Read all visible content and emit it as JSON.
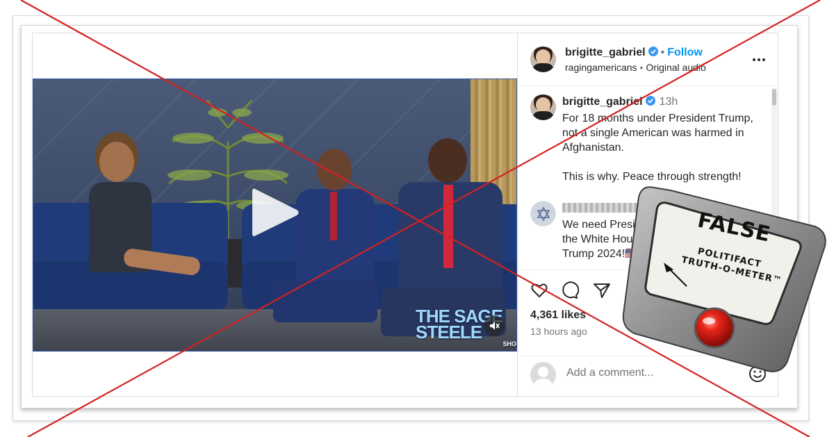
{
  "post": {
    "username": "brigitte_gabriel",
    "follow_label": "Follow",
    "audio_user": "ragingamericans",
    "audio_label": "Original audio",
    "caption_time": "13h",
    "caption_text": "For 18 months under President Trump, not a single American was harmed in Afghanistan.\n\nThis is why. Peace through strength!",
    "comment2_text": "We need Presid\nthe White Hous\nTrump 2024!🇺🇸",
    "likes": "4,361 likes",
    "time_ago": "13 hours ago",
    "add_comment_placeholder": "Add a comment..."
  },
  "video": {
    "show_logo_main": "THE SAGE STEELE",
    "show_logo_sub": "SHO"
  },
  "meter": {
    "rating": "FALSE",
    "brand_line1": "POLITIFACT",
    "brand_line2": "TRUTH-O-METER™"
  },
  "colors": {
    "follow_blue": "#0095f6",
    "x_overlay_red": "#d42020",
    "verified_blue": "#3897f0"
  },
  "icons": [
    "verified-badge-icon",
    "more-options-icon",
    "play-icon",
    "mute-icon",
    "heart-icon",
    "comment-icon",
    "share-icon",
    "emoji-icon",
    "star-of-david-icon",
    "avatar-placeholder-icon",
    "needle-icon"
  ]
}
